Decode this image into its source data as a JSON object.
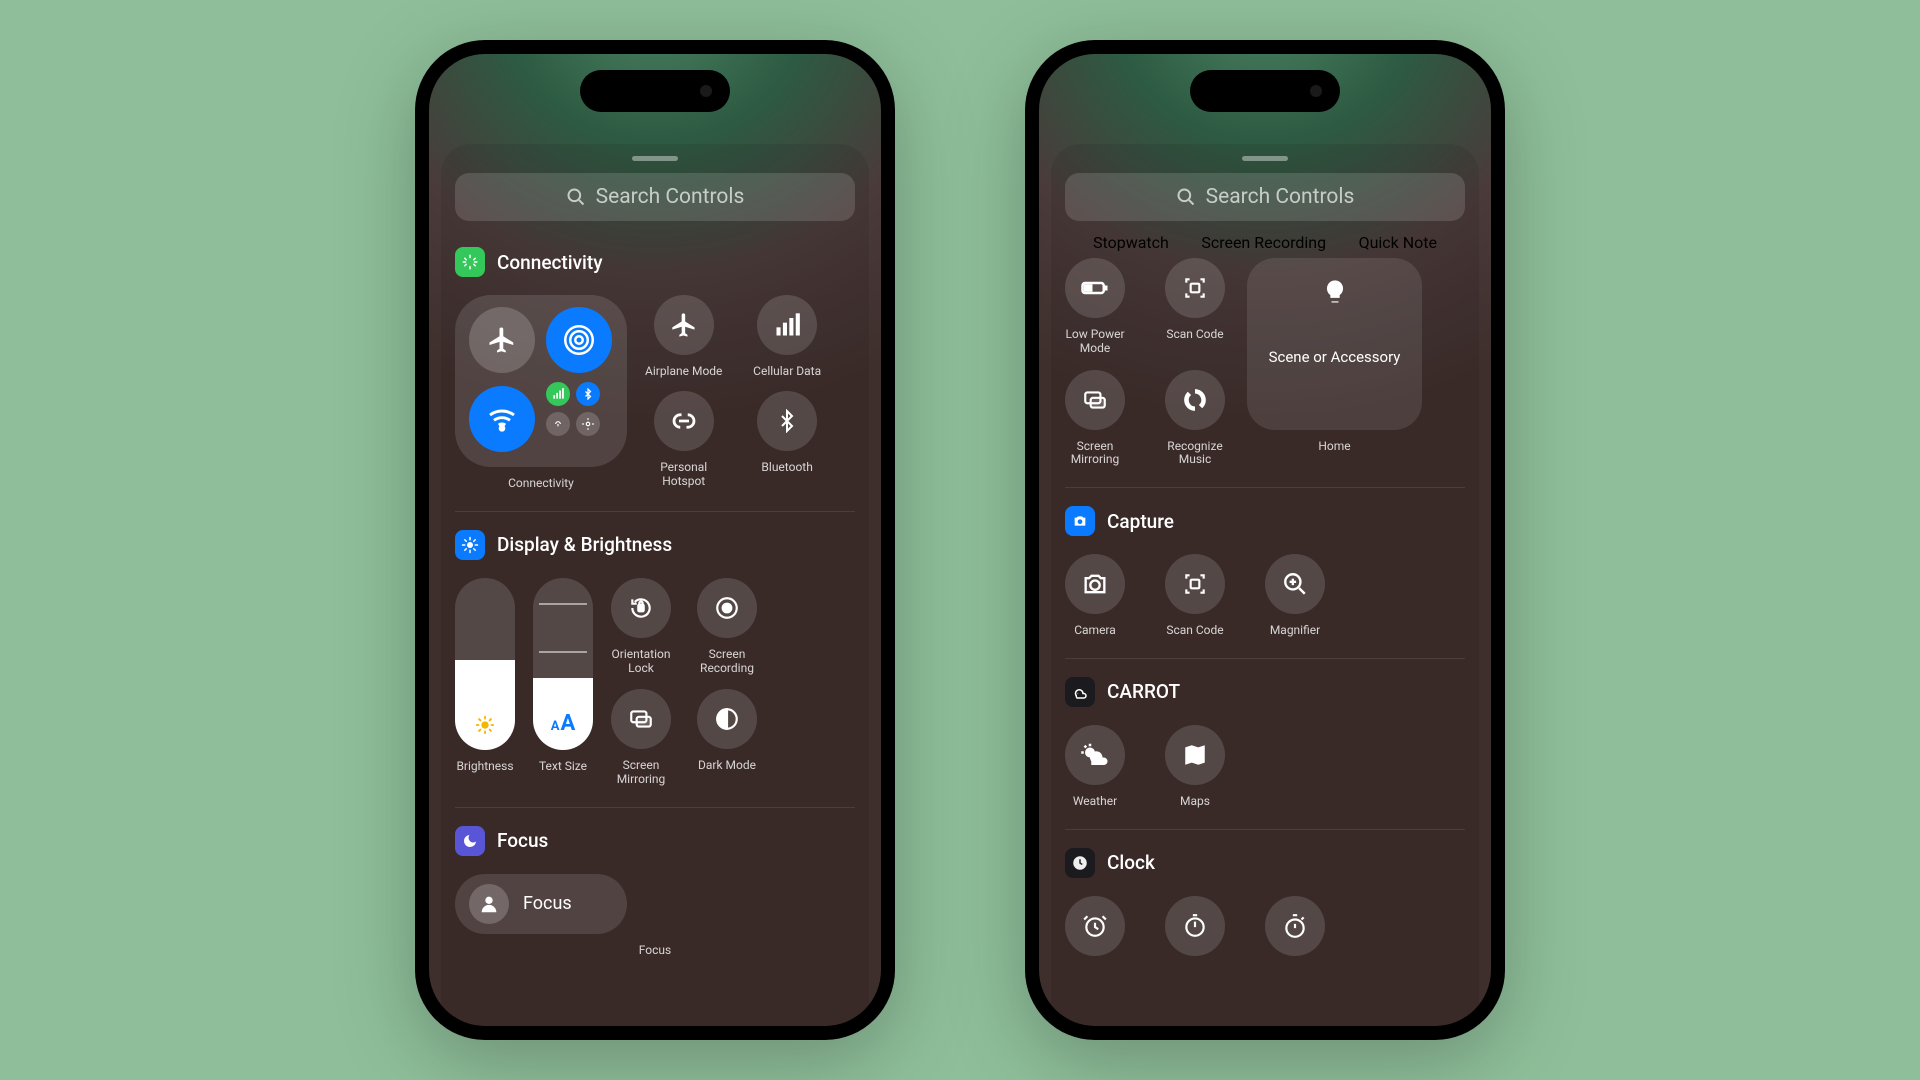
{
  "search_placeholder": "Search Controls",
  "left": {
    "connectivity": {
      "title": "Connectivity",
      "tile_label": "Connectivity",
      "items": [
        {
          "label": "Airplane Mode"
        },
        {
          "label": "Cellular Data"
        },
        {
          "label": "Personal\nHotspot"
        },
        {
          "label": "Bluetooth"
        }
      ]
    },
    "display": {
      "title": "Display & Brightness",
      "sliders": [
        {
          "label": "Brightness",
          "fill": 0.52
        },
        {
          "label": "Text Size",
          "fill": 0.42
        }
      ],
      "items": [
        {
          "label": "Orientation\nLock"
        },
        {
          "label": "Screen\nRecording"
        },
        {
          "label": "Screen\nMirroring"
        },
        {
          "label": "Dark Mode"
        }
      ]
    },
    "focus": {
      "title": "Focus",
      "pill_label": "Focus",
      "bottom_label": "Focus"
    }
  },
  "right": {
    "top_items": {
      "row0": [
        {
          "label": "Stopwatch"
        },
        {
          "label": "Screen\nRecording"
        },
        {
          "label": "Quick Note"
        }
      ],
      "row1a": [
        {
          "label": "Low Power\nMode"
        },
        {
          "label": "Scan Code"
        }
      ],
      "row1b": [
        {
          "label": "Screen\nMirroring"
        },
        {
          "label": "Recognize\nMusic"
        }
      ],
      "home_tile": {
        "accessory_label": "Scene or Accessory",
        "bottom_label": "Home"
      }
    },
    "capture": {
      "title": "Capture",
      "items": [
        {
          "label": "Camera"
        },
        {
          "label": "Scan Code"
        },
        {
          "label": "Magnifier"
        }
      ]
    },
    "carrot": {
      "title": "CARROT",
      "items": [
        {
          "label": "Weather"
        },
        {
          "label": "Maps"
        }
      ]
    },
    "clock": {
      "title": "Clock"
    }
  },
  "colors": {
    "connectivity_badge": "#34c759",
    "display_badge": "#0a7aff",
    "focus_badge": "#5856d6",
    "capture_badge": "#0a7aff",
    "active_blue": "#0a7aff",
    "active_green": "#34c759"
  }
}
